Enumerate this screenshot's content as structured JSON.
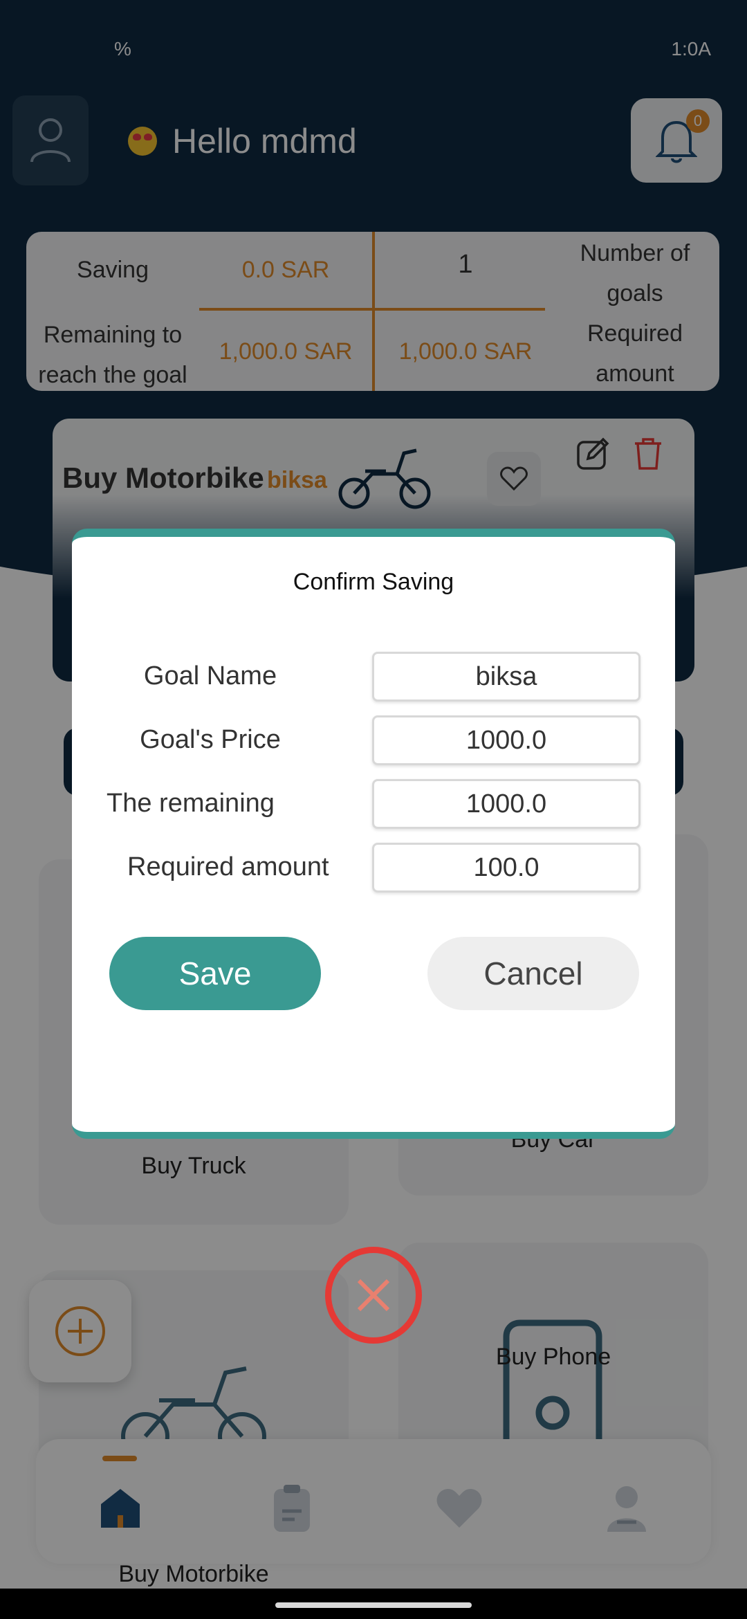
{
  "status_bar": {
    "left_text": "%",
    "right_text": "1:0A"
  },
  "header": {
    "greeting": "Hello mdmd",
    "notification_count": "0"
  },
  "stats": {
    "saving_label": "Saving",
    "saving_value": "0.0 SAR",
    "goals_count_value": "1",
    "goals_count_label": "Number of goals",
    "remaining_label": "Remaining to reach the goal",
    "remaining_value": "1,000.0 SAR",
    "required_value": "1,000.0 SAR",
    "required_label": "Required amount"
  },
  "goal_card": {
    "title": "Buy Motorbike",
    "subtitle": "biksa"
  },
  "tiles": {
    "truck": "Buy Truck",
    "car": "Buy Car",
    "phone": "Buy Phone",
    "motorbike": "Buy Motorbike"
  },
  "modal": {
    "title": "Confirm Saving",
    "fields": [
      {
        "label": "Goal Name",
        "value": "biksa"
      },
      {
        "label": "Goal's Price",
        "value": "1000.0"
      },
      {
        "label": "The remaining",
        "value": "1000.0"
      },
      {
        "label": "Required amount",
        "value": "100.0"
      }
    ],
    "save_label": "Save",
    "cancel_label": "Cancel"
  },
  "colors": {
    "primary": "#3a9a92",
    "accent": "#e08a2b",
    "navy": "#0f2a42",
    "danger": "#e53935"
  }
}
